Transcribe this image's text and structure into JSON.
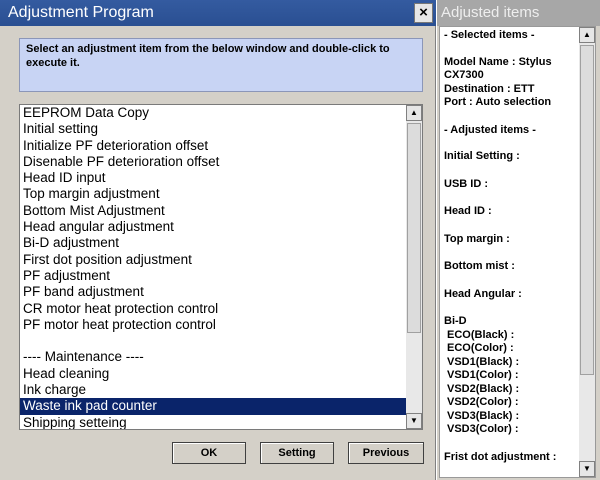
{
  "window": {
    "title": "Adjustment Program",
    "close_glyph": "×",
    "instruction": "Select an adjustment item from the below window and double-click to execute it."
  },
  "list_items": [
    "EEPROM Data Copy",
    "Initial setting",
    "Initialize PF deterioration offset",
    "Disenable PF deterioration offset",
    "Head ID input",
    "Top margin adjustment",
    "Bottom Mist Adjustment",
    "Head angular adjustment",
    "Bi-D adjustment",
    "First dot position adjustment",
    "PF adjustment",
    "PF band adjustment",
    "CR motor heat protection control",
    "PF motor heat protection control",
    "",
    "---- Maintenance ----",
    "Head cleaning",
    "Ink charge",
    "Waste ink pad counter",
    "Shipping setteing"
  ],
  "selected_item": "Waste ink pad counter",
  "buttons": {
    "ok": "OK",
    "setting": "Setting",
    "previous": "Previous"
  },
  "scroll": {
    "up": "▲",
    "down": "▼"
  },
  "side": {
    "title": "Adjusted items",
    "selected_header": "- Selected items -",
    "model": "Model Name : Stylus CX7300",
    "destination": "Destination : ETT",
    "port": "Port : Auto selection",
    "adjusted_header": "- Adjusted items -",
    "initial_setting": "Initial Setting :",
    "usb_id": "USB ID :",
    "head_id": "Head ID :",
    "top_margin": "Top margin :",
    "bottom_mist": "Bottom mist :",
    "head_angular": "Head Angular :",
    "bid": "Bi-D",
    "eco_black": "ECO(Black)  :",
    "eco_color": "ECO(Color)  :",
    "vsd1_black": "VSD1(Black) :",
    "vsd1_color": "VSD1(Color) :",
    "vsd2_black": "VSD2(Black) :",
    "vsd2_color": "VSD2(Color) :",
    "vsd3_black": "VSD3(Black) :",
    "vsd3_color": "VSD3(Color) :",
    "first_dot": "Frist dot adjustment :"
  },
  "colors": {
    "titlebar": "#2a4f92",
    "selection": "#0a246a",
    "instruction_bg": "#c8d4f4"
  }
}
